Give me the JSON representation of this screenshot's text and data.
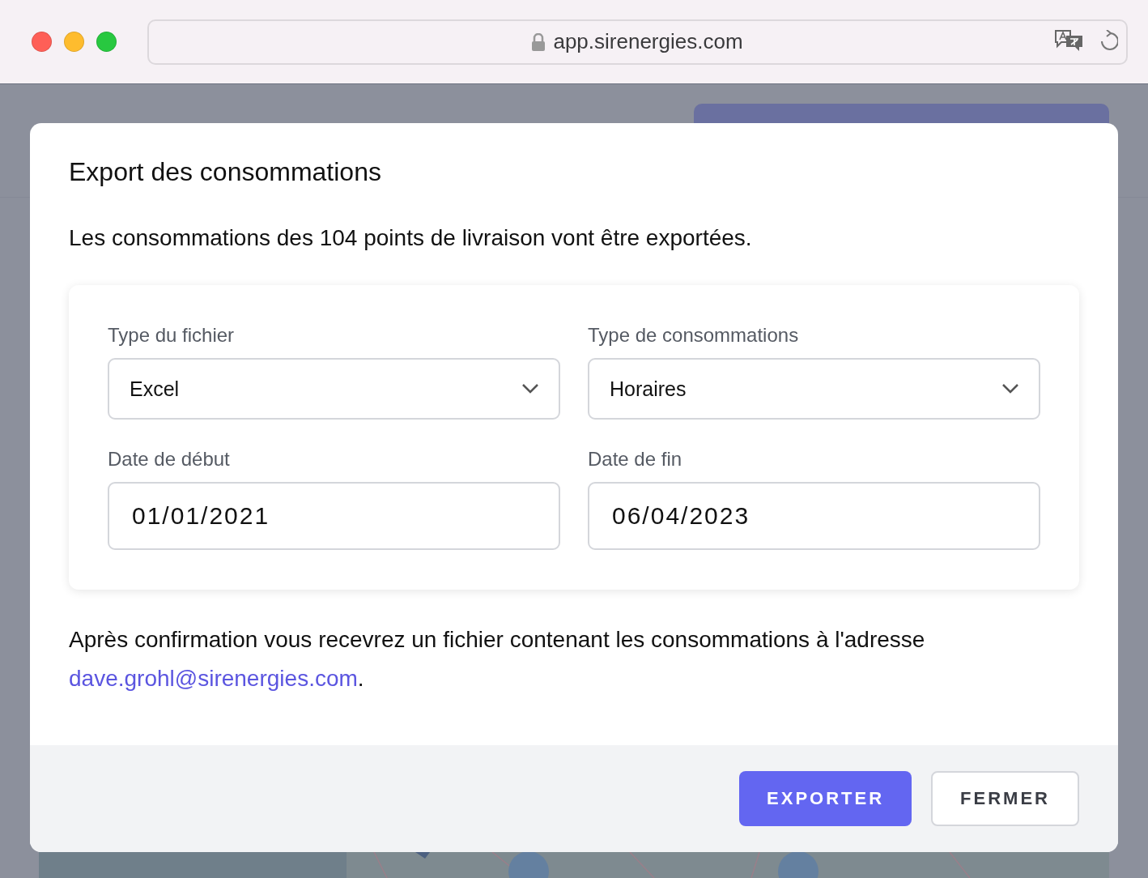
{
  "browser": {
    "url": "app.sirenergies.com"
  },
  "modal": {
    "title": "Export des consommations",
    "intro": "Les consommations des 104 points de livraison vont être exportées.",
    "fields": [
      {
        "kind": "select",
        "label": "Type du fichier",
        "value": "Excel"
      },
      {
        "kind": "select",
        "label": "Type de consommations",
        "value": "Horaires"
      },
      {
        "kind": "date",
        "label": "Date de début",
        "value": "01/01/2021"
      },
      {
        "kind": "date",
        "label": "Date de fin",
        "value": "06/04/2023"
      }
    ],
    "note": {
      "text": "Après confirmation vous recevrez un fichier contenant les consommations à l'adresse",
      "email": "dave.grohl@sirenergies.com",
      "after": "."
    },
    "buttons": [
      {
        "kind": "primary",
        "label": "EXPORTER"
      },
      {
        "kind": "secondary",
        "label": "FERMER"
      }
    ]
  }
}
